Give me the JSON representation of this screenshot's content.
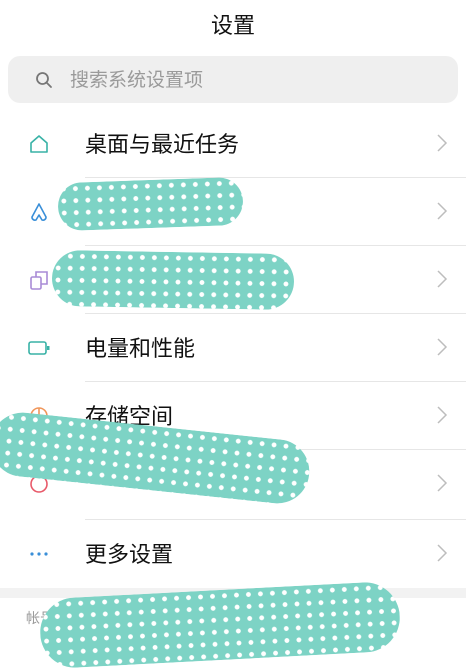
{
  "header": {
    "title": "设置"
  },
  "search": {
    "placeholder": "搜索系统设置项",
    "value": ""
  },
  "items": [
    {
      "label": "桌面与最近任务",
      "icon": "home-icon"
    },
    {
      "label": "",
      "icon": "people-icon"
    },
    {
      "label": "",
      "icon": "copy-icon"
    },
    {
      "label": "电量和性能",
      "icon": "battery-icon"
    },
    {
      "label": "存储空间",
      "icon": "storage-pie-icon"
    },
    {
      "label": "",
      "icon": "circle-icon"
    },
    {
      "label": "更多设置",
      "icon": "more-dots-icon"
    }
  ],
  "section": {
    "label": "帐号"
  },
  "colors": {
    "accent": "#38b2a6",
    "chevron": "#bdbdbd",
    "blur": "#7dd3c5"
  }
}
